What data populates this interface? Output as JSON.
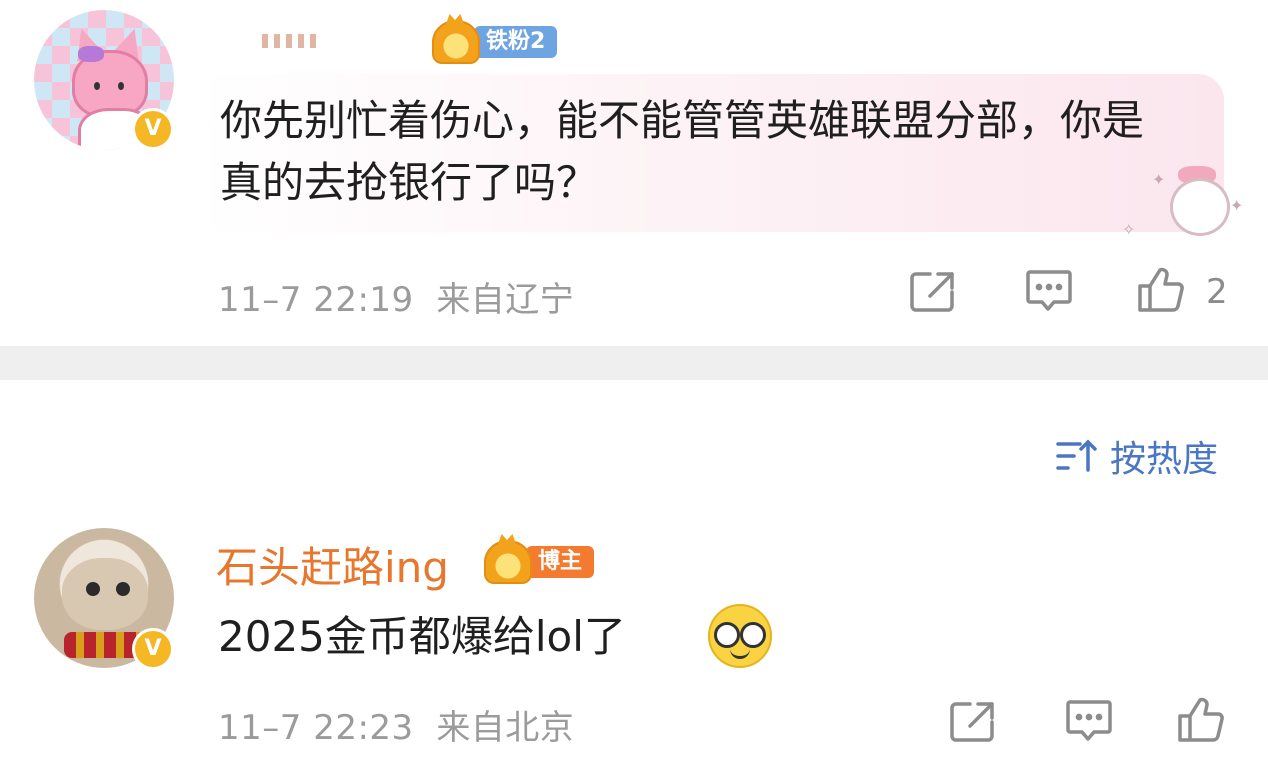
{
  "comments": [
    {
      "username": "",
      "fan_badge": "铁粉2",
      "text": "你先别忙着伤心，能不能管管英雄联盟分部，你是真的去抢银行了吗？",
      "time": "11–7 22:19",
      "location": "来自辽宁",
      "likes": "2",
      "verified": "V"
    },
    {
      "username": "石头赶路ing",
      "fan_badge": "博主",
      "text": "2025金币都爆给lol了",
      "time": "11–7 22:23",
      "location": "来自北京",
      "likes": "",
      "verified": "V"
    }
  ],
  "sort": {
    "label": "按热度"
  },
  "colors": {
    "username_orange": "#e8772d",
    "sort_blue": "#4a76c3",
    "meta_gray": "#9b9b9b",
    "iron_fan_blue": "#6fa4e3",
    "blogger_orange": "#f47a2f",
    "verified_gold": "#f5b723"
  },
  "icons": {
    "share": "share-icon",
    "reply": "comment-icon",
    "like": "thumbs-up-icon",
    "sort": "sort-icon",
    "emoji": "glasses-emoji-icon"
  }
}
